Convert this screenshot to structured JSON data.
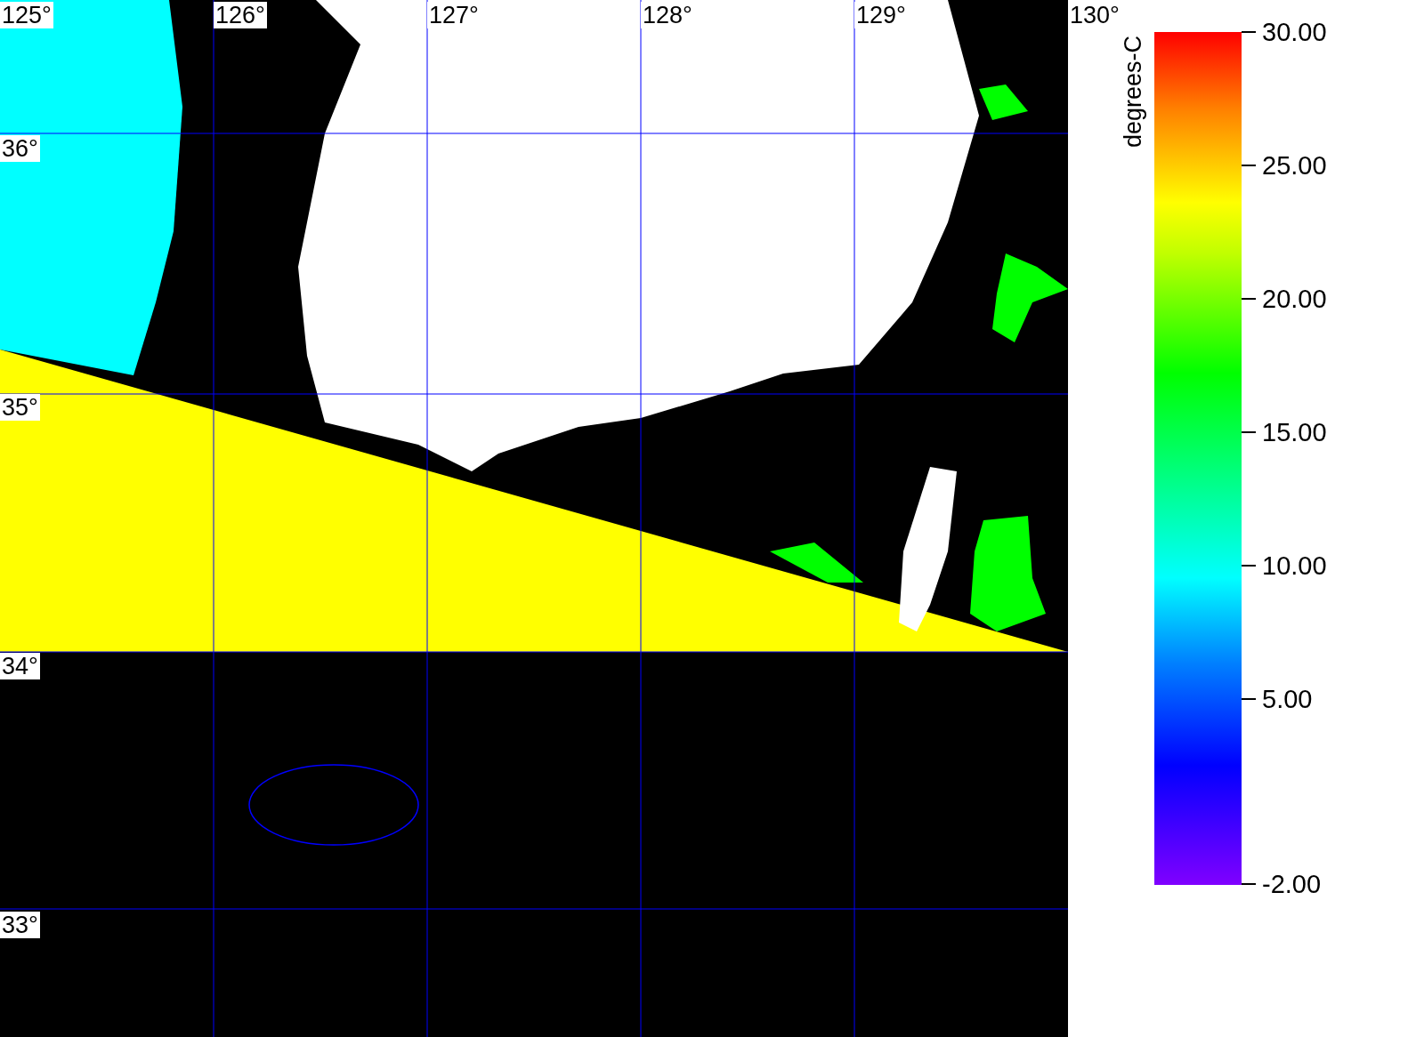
{
  "map": {
    "lon_labels": [
      "125°",
      "126°",
      "127°",
      "128°",
      "129°",
      "130°"
    ],
    "lat_labels": [
      "36°",
      "35°",
      "34°",
      "33°"
    ]
  },
  "colorbar": {
    "title": "degrees-C",
    "ticks": [
      "30.00",
      "25.00",
      "20.00",
      "15.00",
      "10.00",
      "5.00",
      "-2.00"
    ]
  }
}
